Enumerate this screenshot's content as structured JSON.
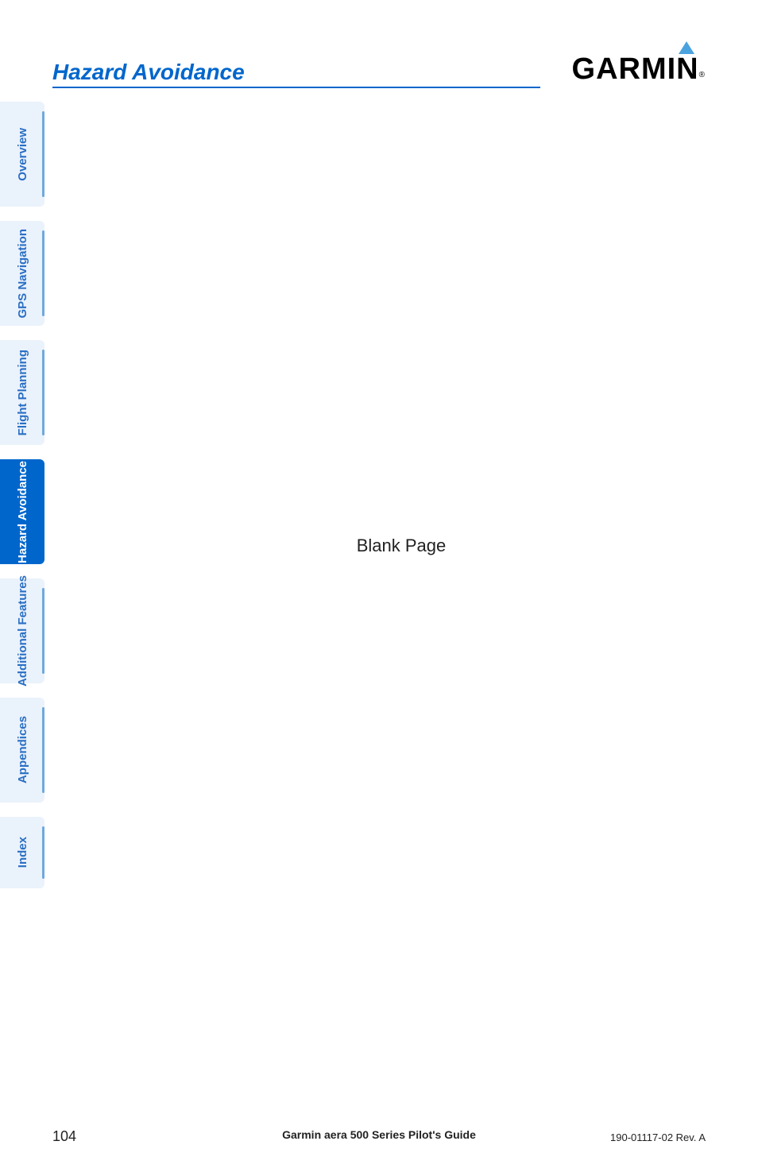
{
  "header": {
    "section_title": "Hazard Avoidance",
    "brand": "GARMIN"
  },
  "sidebar": {
    "tabs": [
      {
        "label": "Overview",
        "active": false
      },
      {
        "label": "GPS Navigation",
        "active": false
      },
      {
        "label": "Flight Planning",
        "active": false
      },
      {
        "label": "Hazard Avoidance",
        "active": true
      },
      {
        "label": "Additional Features",
        "active": false
      },
      {
        "label": "Appendices",
        "active": false
      },
      {
        "label": "Index",
        "active": false
      }
    ]
  },
  "content": {
    "blank_text": "Blank Page"
  },
  "footer": {
    "page_number": "104",
    "center": "Garmin aera 500 Series Pilot's Guide",
    "right": "190-01117-02  Rev. A"
  }
}
